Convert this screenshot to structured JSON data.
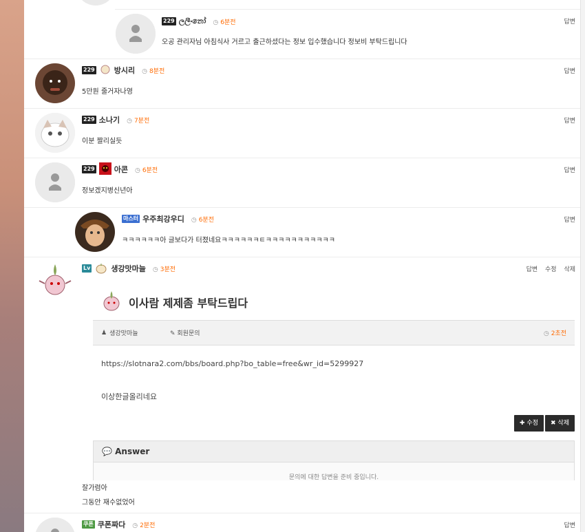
{
  "reply_label": "답변",
  "edit_label": "수정",
  "delete_label": "삭제",
  "comments": [
    {
      "level": "229",
      "nick": "ලලීංනෝ",
      "time": "6분전",
      "text": "오공 관리자님 아침식사 거르고 출근하셨다는 정보 입수했습니다 정보비 부탁드립니다"
    },
    {
      "level": "229",
      "nick": "방시리",
      "time": "8분전",
      "text": "5만원 줄거자나영"
    },
    {
      "level": "229",
      "nick": "소나기",
      "time": "7분전",
      "text": "이분 짤리실듯"
    },
    {
      "level": "229",
      "nick": "아콘",
      "time": "6분전",
      "text": "정보겠지병신년아"
    },
    {
      "level": "마스터",
      "nick": "우주최강우디",
      "time": "6분전",
      "text": "ㅋㅋㅋㅋㅋㅋ아 글보다가 터졌네요ㅋㅋㅋㅋㅋㅋㅌㅋㅋㅋㅋㅋㅋㅋㅋㅋㅋㅋ"
    },
    {
      "level": "Lv",
      "nick": "생강맛마늘",
      "time": "3분전",
      "text_line1": "잘가렴아",
      "text_line2": "그동안 재수없었어"
    },
    {
      "level": "쿠폰",
      "nick": "쿠폰짜다",
      "time": "2분전"
    }
  ],
  "embed": {
    "title": "이사람 제제좀 부탁드립다",
    "author": "생강맛마늘",
    "category": "회원문의",
    "time": "2초전",
    "url": "https://slotnara2.com/bbs/board.php?bo_table=free&wr_id=5299927",
    "body": "이상한글올리네요",
    "edit_btn": "수정",
    "delete_btn": "삭제",
    "answer_title": "Answer",
    "answer_note": "문의에 대한 답변을 준비 중입니다."
  }
}
